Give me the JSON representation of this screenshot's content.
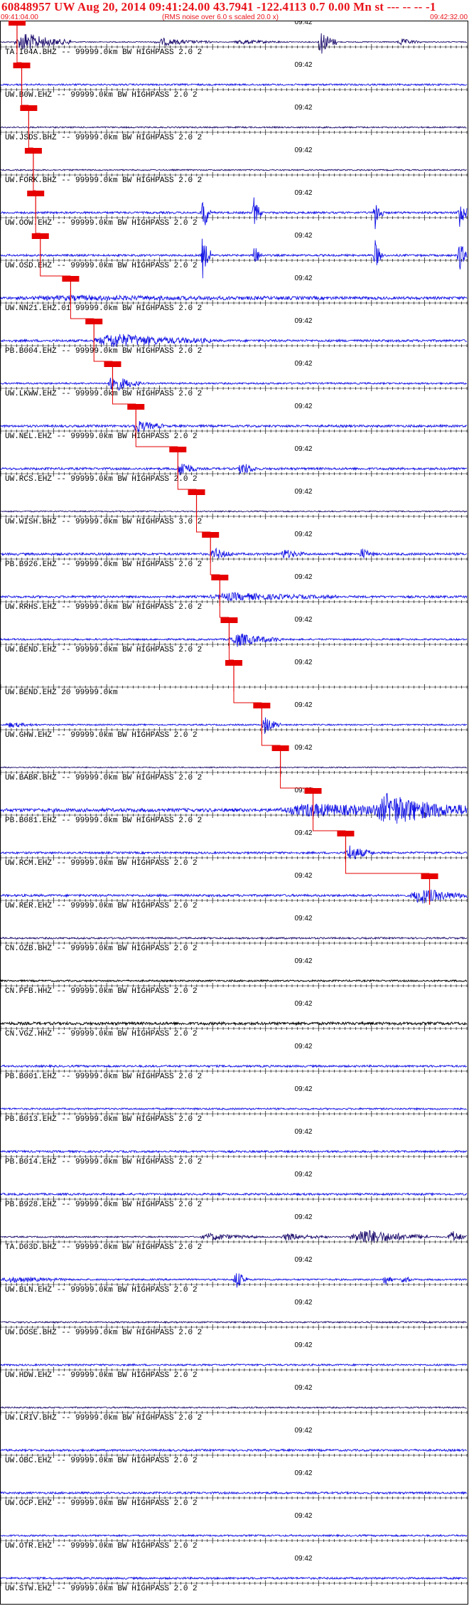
{
  "header": {
    "title": "60848957 UW Aug 20, 2014 09:41:24.00   43.7941 -122.4113  0.7 0.00 Mn st --- -- --  -1",
    "start_time": "09:41:04.00",
    "note": "(RMS noise over 6.0 s scaled 20.0 x)",
    "end_time": "09:42:32.00"
  },
  "minute_mark": "09:42",
  "colors": {
    "blue": "#1414e6",
    "navy": "#1e0f6e",
    "black": "#000000",
    "pick": "#e60000"
  },
  "traces": [
    {
      "label": "TA.I04A.BHZ -- 99999.0km BW  HIGHPASS  2.0  2",
      "color": "navy",
      "noise": 0.18,
      "pick": 0.035,
      "bursts": [
        [
          0.03,
          0.15,
          9
        ],
        [
          0.33,
          0.45,
          3
        ],
        [
          0.5,
          0.6,
          2
        ],
        [
          0.68,
          0.72,
          12
        ],
        [
          0.85,
          0.9,
          3
        ]
      ]
    },
    {
      "label": "UW.B0W.EHZ -- 99999.0km BW  HIGHPASS  2.0  2",
      "color": "blue",
      "noise": 0.3,
      "pick": 0.045,
      "bursts": []
    },
    {
      "label": "UW.JSDS.BHZ -- 99999.0km BW  HIGHPASS  2.0  2",
      "color": "navy",
      "noise": 0.25,
      "pick": 0.06,
      "bursts": []
    },
    {
      "label": "UW.FORK.BHZ -- 99999.0km BW  HIGHPASS  2.0  2",
      "color": "navy",
      "noise": 0.22,
      "pick": 0.07,
      "bursts": []
    },
    {
      "label": "UW.OOW.EHZ -- 99999.0km BW  HIGHPASS  2.0  2",
      "color": "blue",
      "noise": 0.35,
      "pick": 0.075,
      "bursts": [
        [
          0.43,
          0.45,
          22
        ],
        [
          0.54,
          0.56,
          14
        ],
        [
          0.8,
          0.82,
          16
        ],
        [
          0.98,
          1.0,
          18
        ]
      ]
    },
    {
      "label": "UW.OSD.EHZ -- 99999.0km BW  HIGHPASS  2.0  2",
      "color": "blue",
      "noise": 0.35,
      "pick": 0.085,
      "bursts": [
        [
          0.43,
          0.45,
          20
        ],
        [
          0.54,
          0.56,
          10
        ],
        [
          0.8,
          0.82,
          14
        ],
        [
          0.98,
          1.0,
          16
        ]
      ]
    },
    {
      "label": "UW.NN21.EHZ.01 99999.0km BW  HIGHPASS  2.0  2",
      "color": "blue",
      "noise": 0.35,
      "pick": 0.15,
      "bursts": [
        [
          0.0,
          1.0,
          1.6
        ]
      ]
    },
    {
      "label": "PB.B004.EHZ -- 99999.0km BW  HIGHPASS  2.0  2",
      "color": "blue",
      "noise": 0.4,
      "pick": 0.2,
      "bursts": [
        [
          0.2,
          0.45,
          6
        ]
      ]
    },
    {
      "label": "UW.LKWW.EHZ -- 99999.0km BW  HIGHPASS  2.0  2",
      "color": "blue",
      "noise": 0.3,
      "pick": 0.24,
      "bursts": [
        [
          0.23,
          0.3,
          8
        ]
      ]
    },
    {
      "label": "UW.NEL.EHZ -- 99999.0km BW  HIGHPASS  2.0  2",
      "color": "blue",
      "noise": 0.4,
      "pick": 0.29,
      "bursts": [
        [
          0.28,
          0.35,
          5
        ]
      ]
    },
    {
      "label": "UW.RCS.EHZ -- 99999.0km BW  HIGHPASS  2.0  2",
      "color": "blue",
      "noise": 0.4,
      "pick": 0.38,
      "bursts": [
        [
          0.38,
          0.42,
          8
        ],
        [
          0.51,
          0.55,
          6
        ]
      ]
    },
    {
      "label": "UW.WISH.BHZ -- 99999.0km BW  HIGHPASS  3.0  2",
      "color": "navy",
      "noise": 0.2,
      "pick": 0.42,
      "bursts": []
    },
    {
      "label": "PB.B926.EHZ -- 99999.0km BW  HIGHPASS  2.0  2",
      "color": "blue",
      "noise": 0.4,
      "pick": 0.45,
      "bursts": [
        [
          0.45,
          0.5,
          5
        ],
        [
          0.6,
          0.65,
          4
        ],
        [
          0.77,
          0.8,
          5
        ]
      ]
    },
    {
      "label": "UW.RRHS.EHZ -- 99999.0km BW  HIGHPASS  2.0  2",
      "color": "blue",
      "noise": 0.4,
      "pick": 0.47,
      "bursts": [
        [
          0.45,
          0.72,
          3
        ]
      ]
    },
    {
      "label": "UW.BEND.EHZ -- 99999.0km BW  HIGHPASS  2.0  2",
      "color": "blue",
      "noise": 0.3,
      "pick": 0.49,
      "bursts": [
        [
          0.49,
          0.6,
          6
        ]
      ]
    },
    {
      "label": "UW.BEND.EHZ 20 99999.0km",
      "color": "blue",
      "noise": 0.0,
      "pick": 0.5,
      "bursts": []
    },
    {
      "label": "UW.GHW.EHZ -- 99999.0km BW  HIGHPASS  2.0  2",
      "color": "blue",
      "noise": 0.25,
      "pick": 0.56,
      "bursts": [
        [
          0.01,
          0.08,
          2
        ],
        [
          0.56,
          0.6,
          8
        ]
      ]
    },
    {
      "label": "UW.BABR.BHZ -- 99999.0km BW  HIGHPASS  2.0  2",
      "color": "navy",
      "noise": 0.2,
      "pick": 0.6,
      "bursts": []
    },
    {
      "label": "PB.B081.EHZ -- 99999.0km BW  HIGHPASS  2.0  2",
      "color": "blue",
      "noise": 0.6,
      "pick": 0.67,
      "bursts": [
        [
          0.6,
          1.0,
          5
        ],
        [
          0.8,
          1.0,
          12
        ]
      ]
    },
    {
      "label": "UW.RCM.EHZ -- 99999.0km BW  HIGHPASS  2.0  2",
      "color": "blue",
      "noise": 0.35,
      "pick": 0.74,
      "bursts": [
        [
          0.74,
          0.8,
          7
        ]
      ]
    },
    {
      "label": "UW.RER.EHZ -- 99999.0km BW  HIGHPASS  2.0  2",
      "color": "blue",
      "noise": 0.4,
      "pick": 0.92,
      "bursts": [
        [
          0.88,
          1.0,
          7
        ]
      ]
    },
    {
      "label": "CN.OZB.BHZ -- 99999.0km BW  HIGHPASS  2.0  2",
      "color": "navy",
      "noise": 0.3,
      "pick": null,
      "bursts": []
    },
    {
      "label": "CN.PFB.HHZ -- 99999.0km BW  HIGHPASS  2.0  2",
      "color": "black",
      "noise": 0.3,
      "pick": null,
      "bursts": []
    },
    {
      "label": "CN.VGZ.HHZ -- 99999.0km BW  HIGHPASS  2.0  2",
      "color": "black",
      "noise": 0.5,
      "pick": null,
      "bursts": []
    },
    {
      "label": "PB.B001.EHZ -- 99999.0km BW  HIGHPASS  2.0  2",
      "color": "blue",
      "noise": 0.35,
      "pick": null,
      "bursts": []
    },
    {
      "label": "PB.B013.EHZ -- 99999.0km BW  HIGHPASS  2.0  2",
      "color": "blue",
      "noise": 0.3,
      "pick": null,
      "bursts": []
    },
    {
      "label": "PB.B014.EHZ -- 99999.0km BW  HIGHPASS  2.0  2",
      "color": "blue",
      "noise": 0.35,
      "pick": null,
      "bursts": []
    },
    {
      "label": "PB.B928.EHZ -- 99999.0km BW  HIGHPASS  2.0  2",
      "color": "blue",
      "noise": 0.35,
      "pick": null,
      "bursts": []
    },
    {
      "label": "TA.D03D.BHZ -- 99999.0km BW  HIGHPASS  2.0  2",
      "color": "navy",
      "noise": 0.25,
      "pick": null,
      "bursts": [
        [
          0.43,
          0.55,
          3
        ],
        [
          0.6,
          0.7,
          3
        ],
        [
          0.75,
          0.92,
          7
        ],
        [
          0.96,
          1.0,
          6
        ]
      ]
    },
    {
      "label": "UW.BLN.EHZ -- 99999.0km BW  HIGHPASS  2.0  2",
      "color": "blue",
      "noise": 0.3,
      "pick": null,
      "bursts": [
        [
          0.0,
          0.15,
          2
        ],
        [
          0.5,
          0.53,
          9
        ],
        [
          0.82,
          0.84,
          6
        ],
        [
          0.86,
          0.88,
          5
        ]
      ]
    },
    {
      "label": "UW.DOSE.BHZ -- 99999.0km BW  HIGHPASS  2.0  2",
      "color": "navy",
      "noise": 0.25,
      "pick": null,
      "bursts": []
    },
    {
      "label": "UW.HDW.EHZ -- 99999.0km BW  HIGHPASS  2.0  2",
      "color": "blue",
      "noise": 0.3,
      "pick": null,
      "bursts": []
    },
    {
      "label": "UW.LRIV.BHZ -- 99999.0km BW  HIGHPASS  2.0  2",
      "color": "navy",
      "noise": 0.25,
      "pick": null,
      "bursts": []
    },
    {
      "label": "UW.OBC.EHZ -- 99999.0km BW  HIGHPASS  2.0  2",
      "color": "blue",
      "noise": 0.35,
      "pick": null,
      "bursts": []
    },
    {
      "label": "UW.OCP.EHZ -- 99999.0km BW  HIGHPASS  2.0  2",
      "color": "blue",
      "noise": 0.35,
      "pick": null,
      "bursts": []
    },
    {
      "label": "UW.OTR.EHZ -- 99999.0km BW  HIGHPASS  2.0  2",
      "color": "blue",
      "noise": 0.3,
      "pick": null,
      "bursts": []
    },
    {
      "label": "UW.STW.EHZ -- 99999.0km BW  HIGHPASS  2.0  2",
      "color": "blue",
      "noise": 0.35,
      "pick": null,
      "bursts": []
    }
  ]
}
